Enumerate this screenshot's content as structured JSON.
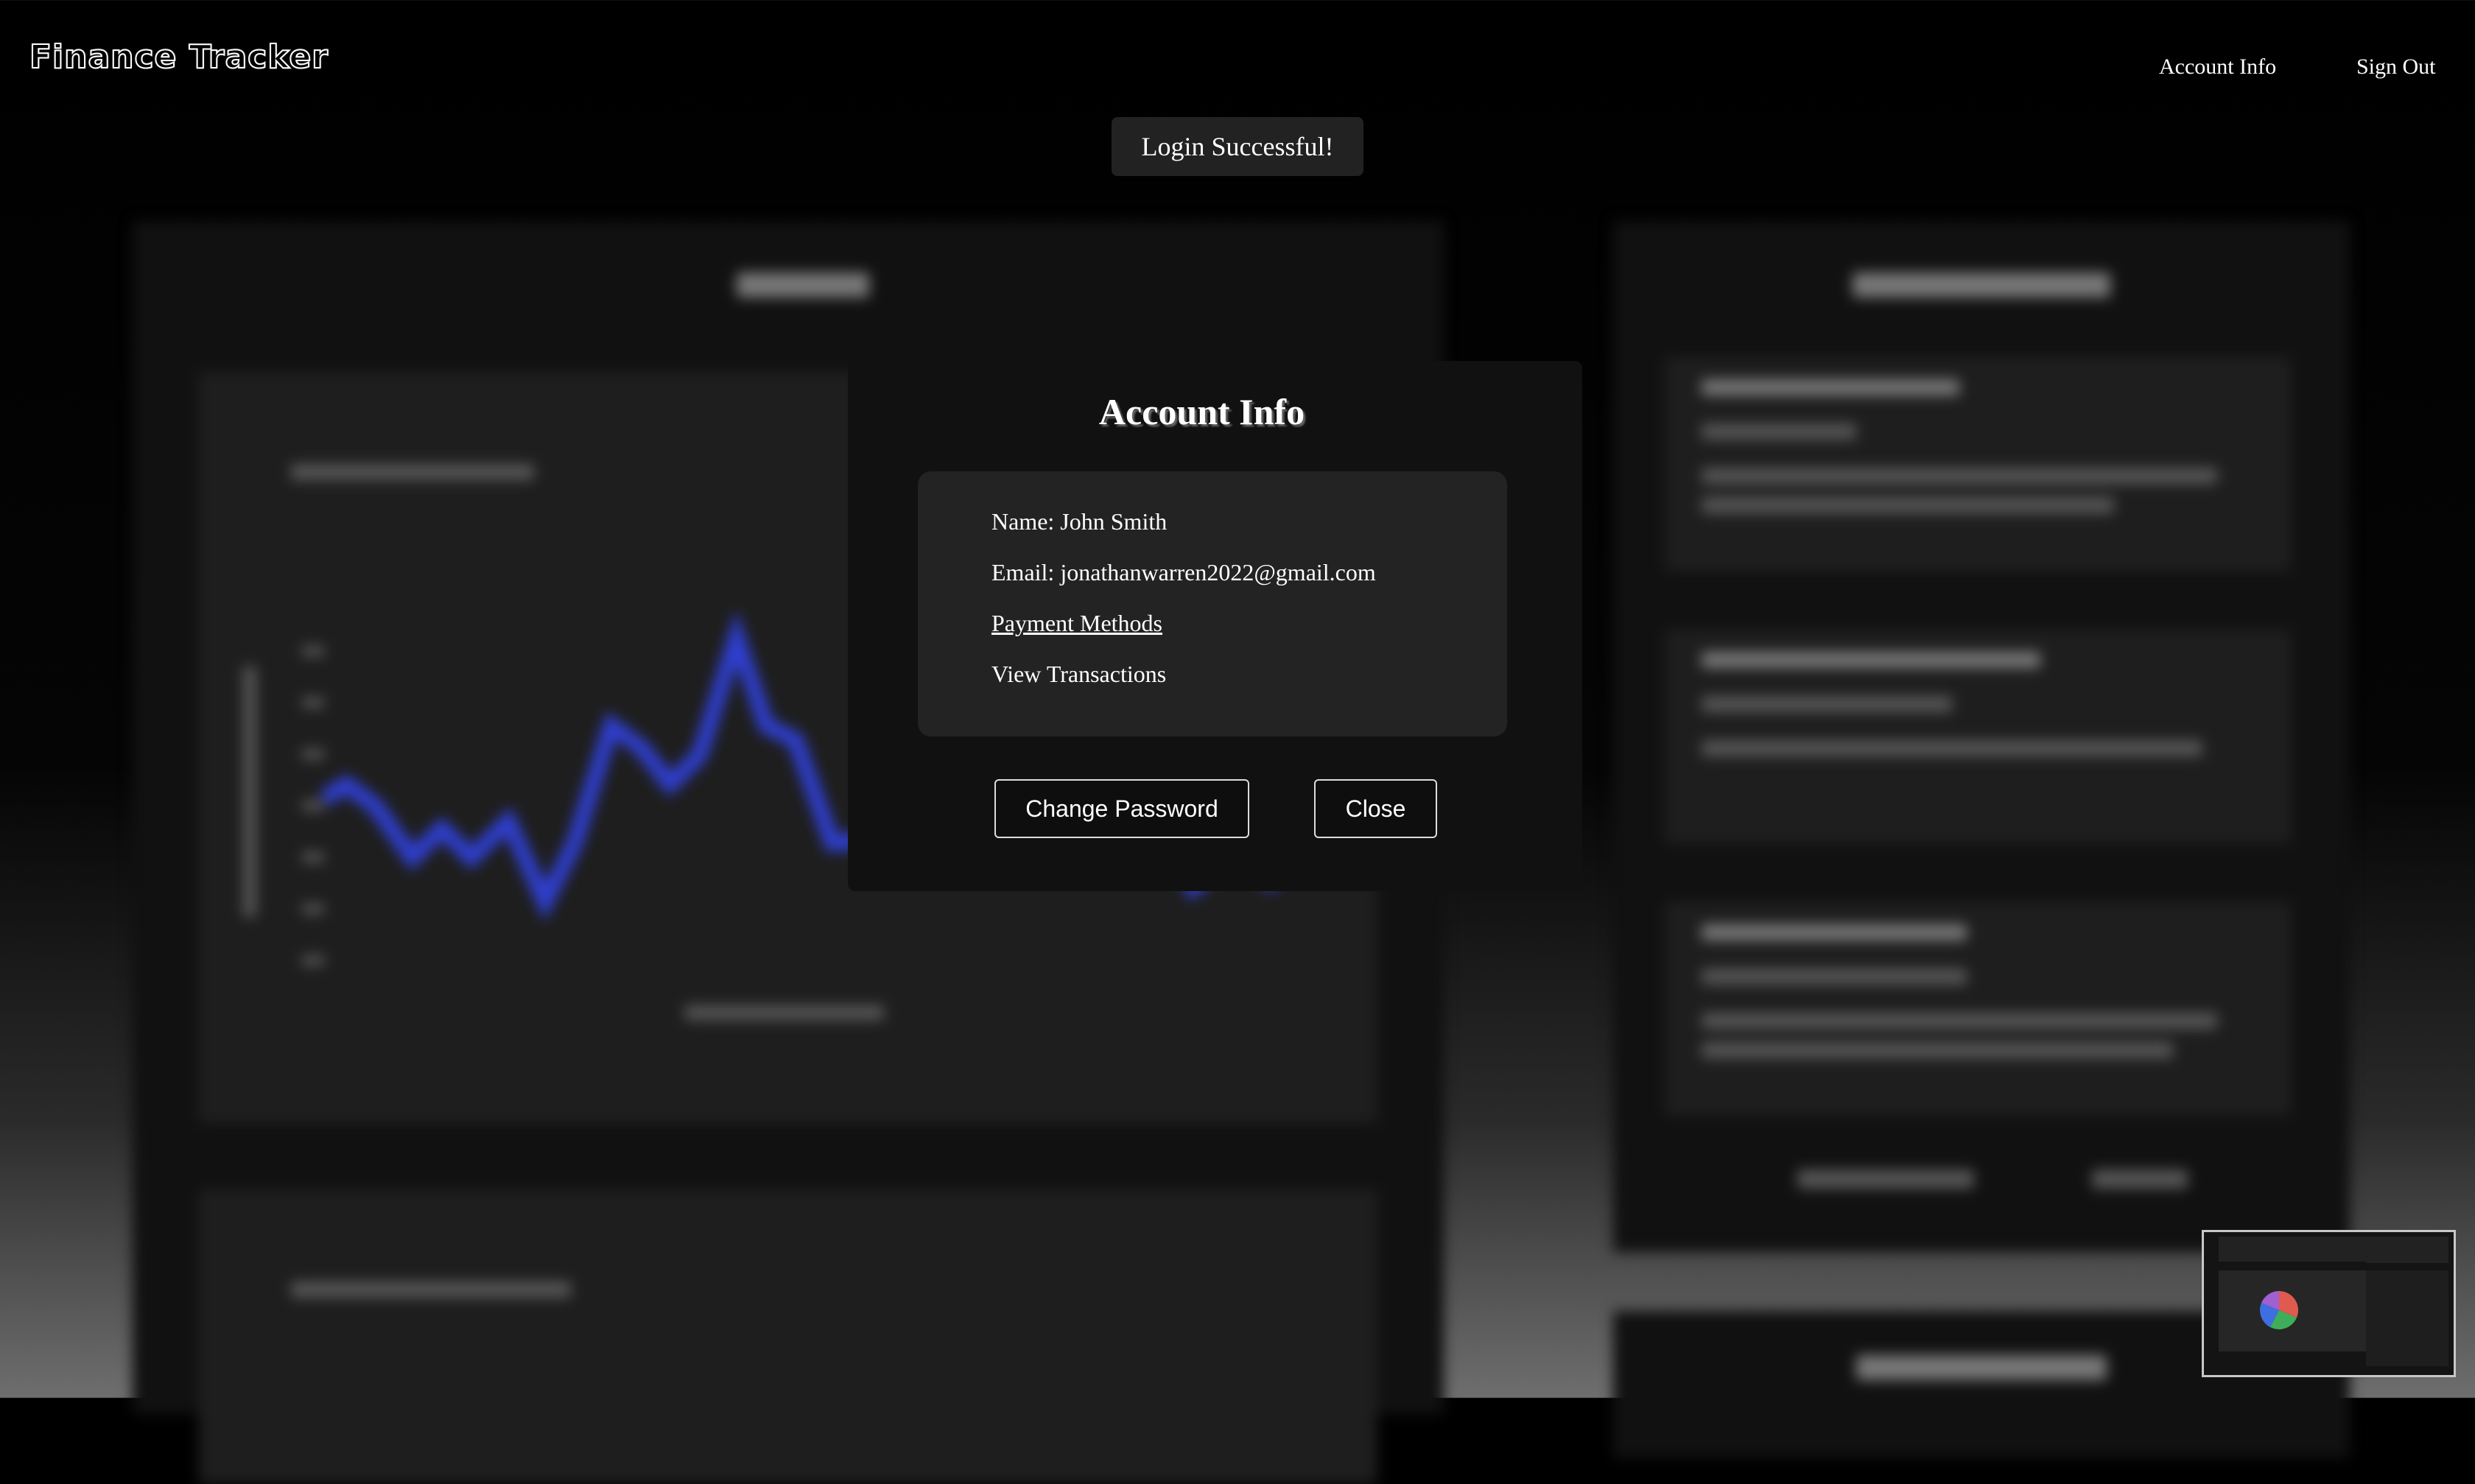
{
  "app": {
    "title": "Finance Tracker"
  },
  "nav": {
    "account_info": "Account Info",
    "sign_out": "Sign Out"
  },
  "toast": {
    "message": "Login Successful!"
  },
  "modal": {
    "title": "Account Info",
    "name_line": "Name: John Smith",
    "email_line": "Email: jonathanwarren2022@gmail.com",
    "payment_methods_link": "Payment Methods",
    "view_transactions": "View Transactions",
    "change_password_label": "Change Password",
    "close_label": "Close"
  },
  "background": {
    "chart_line_color": "#2f3fd0",
    "pie_colors": [
      "#e05a4f",
      "#3fae5a",
      "#3d6fe0",
      "#a060d0"
    ]
  }
}
